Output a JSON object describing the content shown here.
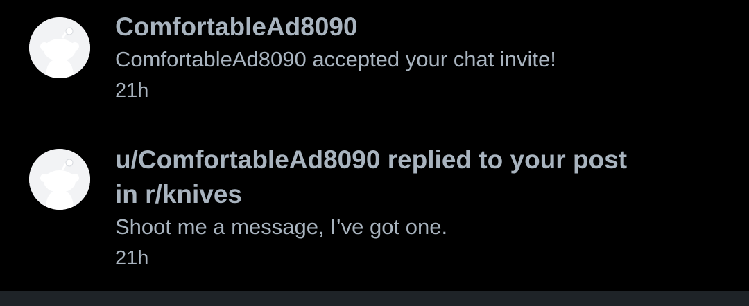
{
  "notifications": [
    {
      "avatar_icon": "reddit-snoo-icon",
      "title": "ComfortableAd8090",
      "body": "ComfortableAd8090 accepted your chat invite!",
      "time": "21h"
    },
    {
      "avatar_icon": "reddit-snoo-icon",
      "title": "u/ComfortableAd8090 replied to your post in r/knives",
      "body": "Shoot me a message, I’ve got one.",
      "time": "21h"
    }
  ],
  "colors": {
    "background": "#000000",
    "text": "#a9b4bf",
    "avatar_background": "#f2f3f5",
    "avatar_figure": "#ffffff",
    "bottom_bar": "#1e2327"
  }
}
